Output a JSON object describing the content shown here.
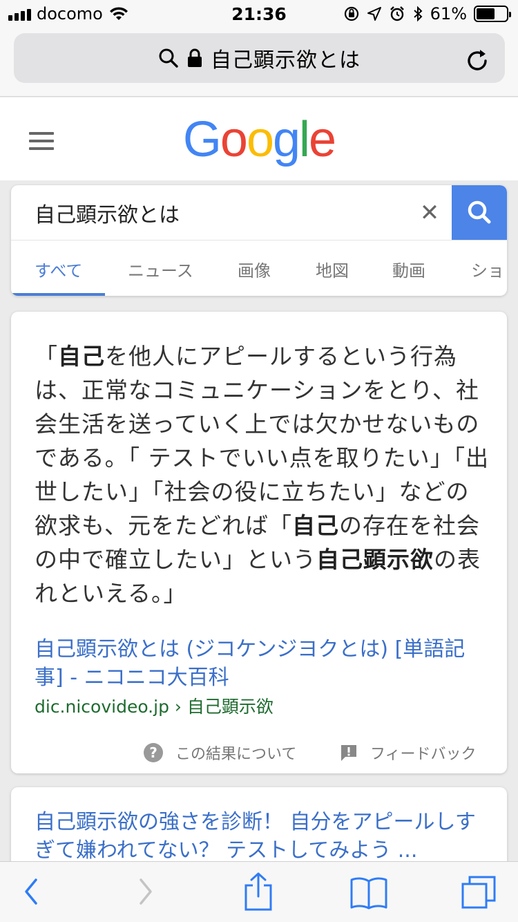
{
  "status_bar": {
    "carrier": "docomo",
    "time": "21:36",
    "battery_percent": "61%",
    "battery_level": 0.61
  },
  "url_bar": {
    "text": "自己顕示欲とは"
  },
  "google": {
    "logo_letters": [
      "G",
      "o",
      "o",
      "g",
      "l",
      "e"
    ],
    "logo_colors": [
      "#4285F4",
      "#EA4335",
      "#FBBC05",
      "#4285F4",
      "#34A853",
      "#EA4335"
    ]
  },
  "search": {
    "query": "自己顕示欲とは",
    "clear_label": "✕"
  },
  "tabs": [
    {
      "label": "すべて",
      "active": true
    },
    {
      "label": "ニュース",
      "active": false
    },
    {
      "label": "画像",
      "active": false
    },
    {
      "label": "地図",
      "active": false
    },
    {
      "label": "動画",
      "active": false
    },
    {
      "label": "ショ",
      "active": false
    }
  ],
  "result1": {
    "snippet_parts": [
      {
        "t": "「",
        "b": false
      },
      {
        "t": "自己",
        "b": true
      },
      {
        "t": "を他人にアピールするという行為は、正常なコミュニケーションをとり、社会生活を送っていく上では欠かせないものである。「 テストでいい点を取りたい」「出世したい」「社会の役に立ちたい」などの欲求も、元をたどれば「",
        "b": false
      },
      {
        "t": "自己",
        "b": true
      },
      {
        "t": "の存在を社会の中で確立したい」という",
        "b": false
      },
      {
        "t": "自己顕示欲",
        "b": true
      },
      {
        "t": "の表れといえる。」",
        "b": false
      }
    ],
    "title": "自己顕示欲とは (ジコケンジヨクとは) [単語記事] - ニコニコ大百科",
    "url_domain": "dic.nicovideo.jp",
    "url_path": " › 自己顕示欲",
    "about_label": "この結果について",
    "feedback_label": "フィードバック"
  },
  "result2": {
    "title": "自己顕示欲の強さを診断！ 自分をアピールしすぎて嫌われてない？ テストしてみよう ..."
  }
}
